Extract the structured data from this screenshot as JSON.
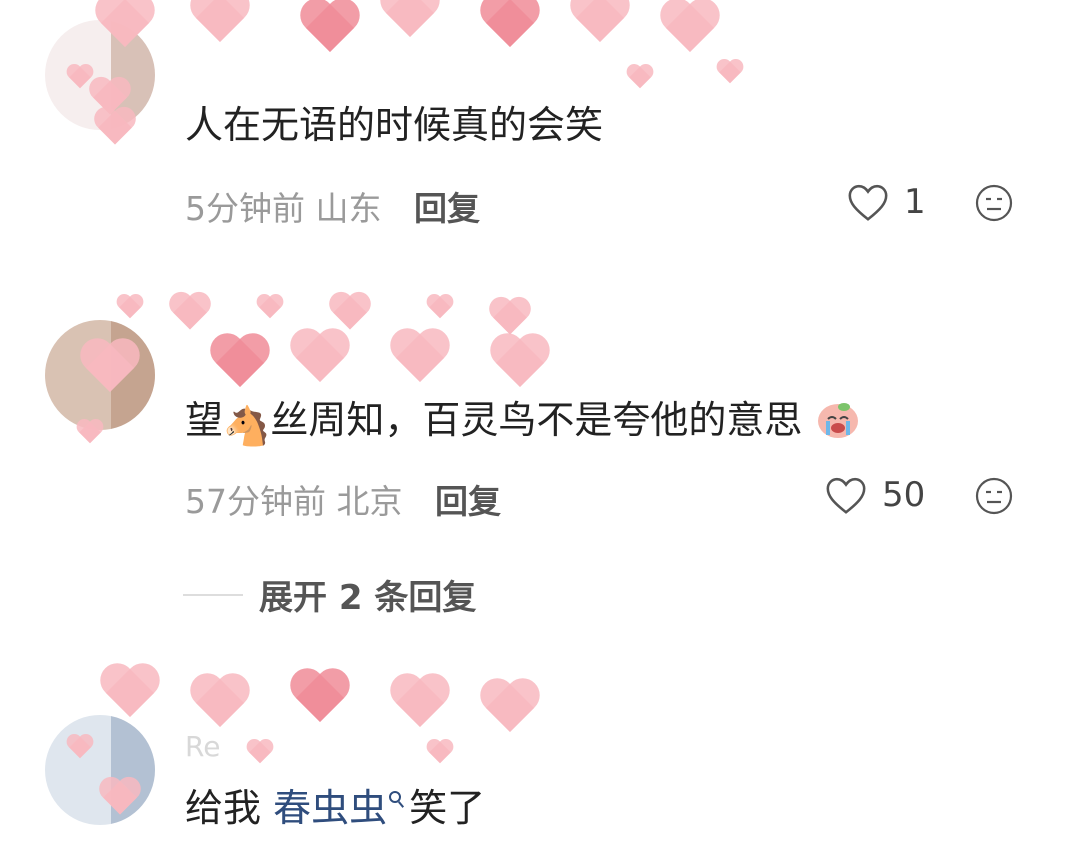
{
  "comments": [
    {
      "text": "人在无语的时候真的会笑",
      "time": "5分钟前",
      "location": "山东",
      "reply_label": "回复",
      "likes": "1"
    },
    {
      "text_before": "望",
      "emoji_horse": "🐴",
      "text_after": "丝周知，百灵鸟不是夸他的意思",
      "time": "57分钟前",
      "location": "北京",
      "reply_label": "回复",
      "likes": "50",
      "expand_label": "展开 2 条回复"
    },
    {
      "username": "Re",
      "text_before": "给我",
      "link_text": "春虫虫",
      "text_after": "笑了"
    }
  ],
  "colors": {
    "accent_link": "#2f4d7d",
    "heart_decor": "#f8b9bf",
    "meta_text": "#9a9a9a"
  },
  "icons": [
    "heart-outline-icon",
    "dislike-face-icon",
    "search-icon",
    "crying-emoji-icon"
  ]
}
